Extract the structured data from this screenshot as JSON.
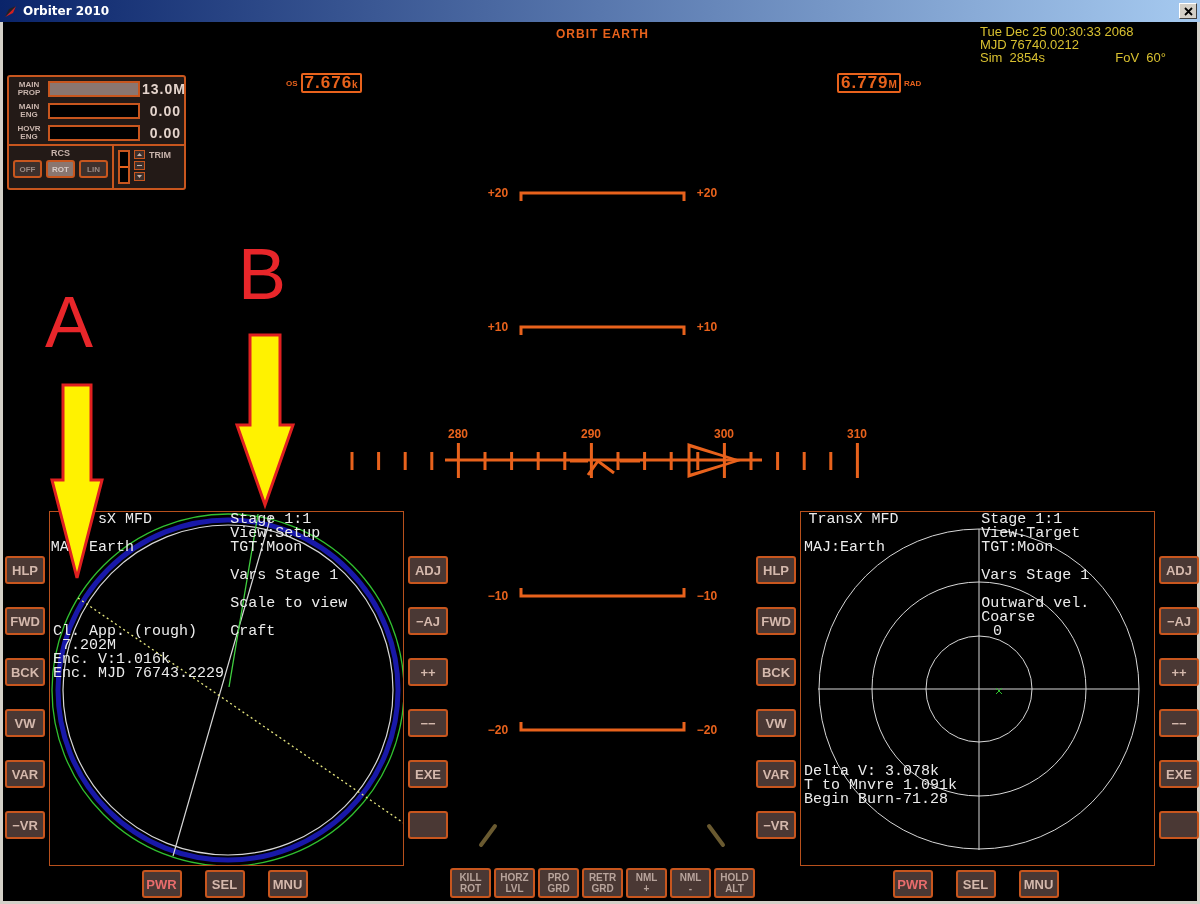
{
  "window": {
    "title": "Orbiter 2010"
  },
  "hud": {
    "mode": "ORBIT EARTH",
    "speed": {
      "label": "OS",
      "value": "7.676",
      "unit": "k"
    },
    "altitude": {
      "value": "6.779",
      "unit": "M",
      "label": "RAD"
    },
    "pitch_ladder": [
      {
        "left": "+20",
        "right": "+20"
      },
      {
        "left": "+10",
        "right": "+10"
      },
      {
        "left": "−10",
        "right": "−10"
      },
      {
        "left": "−20",
        "right": "−20"
      }
    ],
    "heading_labels": [
      "280",
      "290",
      "300",
      "310"
    ]
  },
  "clock": {
    "date": "Tue Dec 25 00:30:33 2068",
    "mjd": "MJD 76740.0212",
    "sim": "Sim  2854s",
    "fov": "FoV  60°"
  },
  "engine_panel": {
    "gauges": [
      {
        "label": [
          "MAIN",
          "PROP"
        ],
        "level": 1,
        "reading": "13.0M"
      },
      {
        "label": [
          "MAIN",
          "ENG"
        ],
        "level": 0,
        "reading": "0.00"
      },
      {
        "label": [
          "HOVR",
          "ENG"
        ],
        "level": 0,
        "reading": "0.00"
      }
    ],
    "rcs": {
      "title": "RCS",
      "modes": [
        {
          "label": "OFF",
          "selected": false
        },
        {
          "label": "ROT",
          "selected": true
        },
        {
          "label": "LIN",
          "selected": false
        }
      ]
    },
    "trim": {
      "title": "TRIM",
      "level": 0.5
    }
  },
  "mfds": [
    {
      "kind": "orbit",
      "texts": [
        "sX MFD",
        "Stage 1:1",
        "View:Setup",
        "MA",
        "Earth",
        "TGT:Moon",
        "Vars Stage 1",
        "Scale to view",
        "Cl. App. (rough)",
        "Craft",
        "7.202M",
        "Enc. V:1.016k",
        "Enc. MJD 76743.2229"
      ],
      "left_buttons": [
        {
          "kind": "labeled",
          "label": "HLP"
        },
        {
          "kind": "labeled",
          "label": "FWD"
        },
        {
          "kind": "labeled",
          "label": "BCK"
        },
        {
          "kind": "labeled",
          "label": "VW"
        },
        {
          "kind": "labeled",
          "label": "VAR"
        },
        {
          "kind": "labeled",
          "label": "−VR"
        }
      ],
      "right_buttons": [
        {
          "kind": "labeled",
          "label": "ADJ"
        },
        {
          "kind": "labeled",
          "label": "−AJ"
        },
        {
          "kind": "labeled",
          "label": "++"
        },
        {
          "kind": "labeled",
          "label": "−−"
        },
        {
          "kind": "labeled",
          "label": "EXE"
        },
        {
          "kind": "blank"
        }
      ],
      "bottom_buttons": [
        "PWR",
        "SEL",
        "MNU"
      ]
    },
    {
      "kind": "target",
      "texts": [
        "TransX MFD",
        "Stage 1:1",
        "View:Target",
        "MAJ:Earth",
        "TGT:Moon",
        "Vars Stage 1",
        "Outward vel.",
        "Coarse",
        "0",
        "Delta V: 3.078k",
        "T to Mnvre 1.091k",
        "Begin Burn-71.28"
      ],
      "left_buttons": [
        {
          "kind": "labeled",
          "label": "HLP"
        },
        {
          "kind": "labeled",
          "label": "FWD"
        },
        {
          "kind": "labeled",
          "label": "BCK"
        },
        {
          "kind": "labeled",
          "label": "VW"
        },
        {
          "kind": "labeled",
          "label": "VAR"
        },
        {
          "kind": "labeled",
          "label": "−VR"
        }
      ],
      "right_buttons": [
        {
          "kind": "labeled",
          "label": "ADJ"
        },
        {
          "kind": "labeled",
          "label": "−AJ"
        },
        {
          "kind": "labeled",
          "label": "++"
        },
        {
          "kind": "labeled",
          "label": "−−"
        },
        {
          "kind": "labeled",
          "label": "EXE"
        },
        {
          "kind": "blank"
        }
      ],
      "bottom_buttons": [
        "PWR",
        "SEL",
        "MNU"
      ]
    }
  ],
  "nav_buttons": [
    {
      "lines": [
        "KILL",
        "ROT"
      ]
    },
    {
      "lines": [
        "HORZ",
        "LVL"
      ]
    },
    {
      "lines": [
        "PRO",
        "GRD"
      ]
    },
    {
      "lines": [
        "RETR",
        "GRD"
      ]
    },
    {
      "lines": [
        "NML",
        "+"
      ]
    },
    {
      "lines": [
        "NML",
        "-"
      ]
    },
    {
      "lines": [
        "HOLD",
        "ALT"
      ]
    }
  ],
  "annotations": [
    {
      "label": "A"
    },
    {
      "label": "B"
    }
  ]
}
